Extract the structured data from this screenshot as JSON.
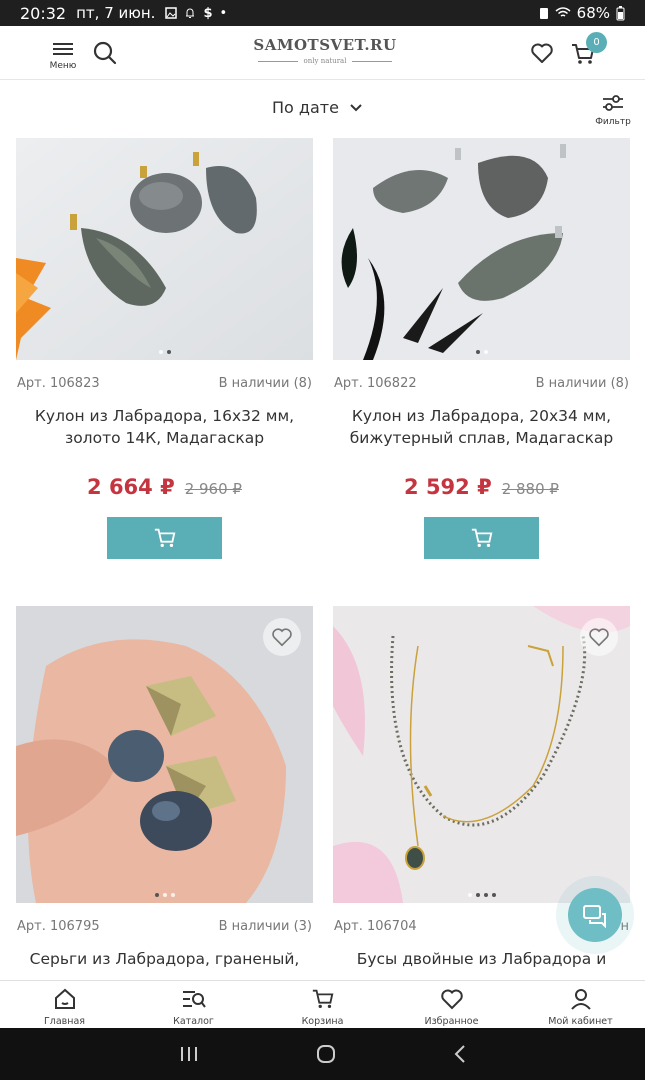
{
  "status_bar": {
    "time": "20:32",
    "date": "пт, 7 июн.",
    "battery": "68%"
  },
  "header": {
    "menu_label": "Меню",
    "logo_name": "SAMOTSVET.RU",
    "logo_tagline": "only natural",
    "cart_count": "0"
  },
  "sort": {
    "label": "По дате",
    "filter_label": "Фильтр"
  },
  "products": [
    {
      "article": "Арт. 106823",
      "stock": "В наличии (8)",
      "title": "Кулон из Лабрадора, 16х32 мм, золото 14К, Мадагаскар",
      "price": "2 664 ₽",
      "old_price": "2 960 ₽"
    },
    {
      "article": "Арт. 106822",
      "stock": "В наличии (8)",
      "title": "Кулон из Лабрадора, 20х34 мм, бижутерный сплав, Мадагаскар",
      "price": "2 592 ₽",
      "old_price": "2 880 ₽"
    },
    {
      "article": "Арт. 106795",
      "stock": "В наличии (3)",
      "title": "Серьги из Лабрадора, граненый,"
    },
    {
      "article": "Арт. 106704",
      "stock": "В н",
      "title": "Бусы двойные из Лабрадора и"
    }
  ],
  "bottom_nav": [
    {
      "label": "Главная",
      "icon": "home-icon"
    },
    {
      "label": "Каталог",
      "icon": "catalog-icon"
    },
    {
      "label": "Корзина",
      "icon": "cart-icon"
    },
    {
      "label": "Избранное",
      "icon": "heart-icon"
    },
    {
      "label": "Мой кабинет",
      "icon": "user-icon"
    }
  ],
  "colors": {
    "accent": "#5aaeb6",
    "price": "#c4353f"
  }
}
